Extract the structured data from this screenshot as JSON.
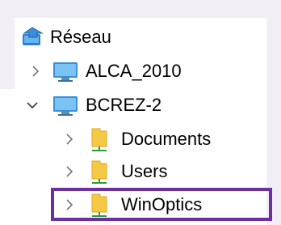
{
  "tree": {
    "items": [
      {
        "label": "Réseau",
        "icon": "network-icon",
        "expand": "none"
      },
      {
        "label": "ALCA_2010",
        "icon": "computer-icon",
        "expand": "collapsed"
      },
      {
        "label": "BCREZ-2",
        "icon": "computer-icon",
        "expand": "expanded"
      },
      {
        "label": "Documents",
        "icon": "shared-folder-icon",
        "expand": "collapsed"
      },
      {
        "label": "Users",
        "icon": "shared-folder-icon",
        "expand": "collapsed"
      },
      {
        "label": "WinOptics",
        "icon": "shared-folder-icon",
        "expand": "collapsed",
        "highlighted": true
      }
    ]
  },
  "colors": {
    "highlight_border": "#6b2fa0",
    "folder_yellow": "#f6c944",
    "share_green": "#2e9b3a",
    "monitor_blue": "#3a8fd8"
  }
}
